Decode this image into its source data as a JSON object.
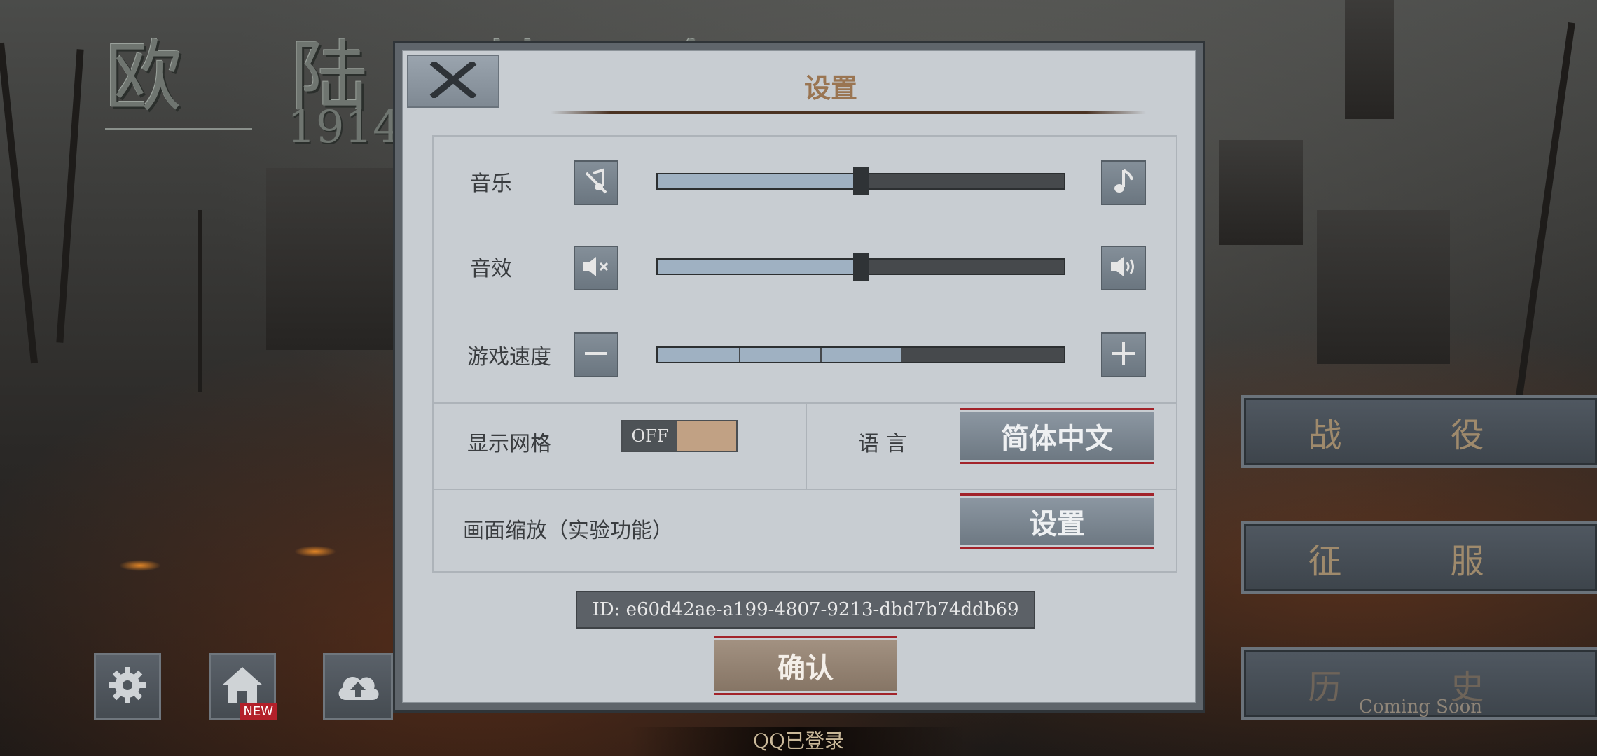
{
  "background": {
    "game_title": "欧 陆 战 争",
    "game_year": "1914"
  },
  "side_menu": {
    "campaign_label": "战 役",
    "conquest_label": "征 服",
    "history_label": "历 史",
    "history_sublabel": "Coming Soon"
  },
  "bottom_bar": {
    "new_badge": "NEW",
    "qq_status": "QQ已登录"
  },
  "dialog": {
    "title": "设置",
    "music": {
      "label": "音乐",
      "level": 0.5
    },
    "sound": {
      "label": "音效",
      "level": 0.5
    },
    "speed": {
      "label": "游戏速度",
      "level": 3,
      "max": 5
    },
    "grid": {
      "label": "显示网格",
      "state": "OFF"
    },
    "language": {
      "label": "语 言",
      "value": "简体中文"
    },
    "zoom": {
      "label": "画面缩放（实验功能）",
      "button": "设置"
    },
    "id_text": "ID: e60d42ae-a199-4807-9213-dbd7b74ddb69",
    "confirm": "确认"
  },
  "colors": {
    "accent_red": "#a2232a",
    "title_brown": "#9a7552",
    "slider_fill": "#9fb1c2"
  },
  "icons": [
    "close-icon",
    "music-mute-icon",
    "music-note-icon",
    "sound-mute-icon",
    "sound-on-icon",
    "minus-icon",
    "plus-icon",
    "gear-icon",
    "home-icon",
    "cloud-upload-icon"
  ]
}
